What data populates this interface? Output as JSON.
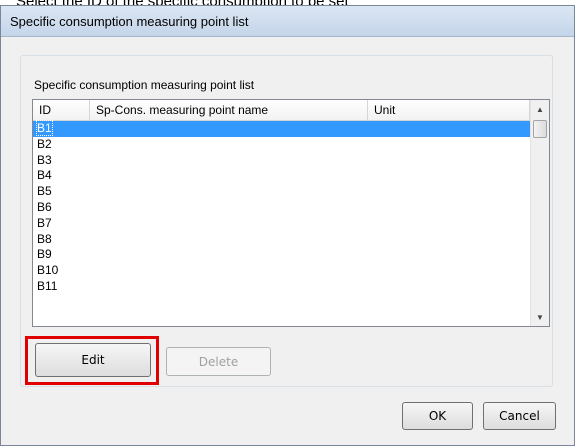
{
  "caption": {
    "text": "Select the ID of the specific consumption to be set"
  },
  "dialog": {
    "title": "Specific consumption measuring point list",
    "group_label": "Specific consumption measuring point list",
    "list": {
      "columns": [
        "ID",
        "Sp-Cons. measuring point name",
        "Unit"
      ],
      "rows": [
        "B1",
        "B2",
        "B3",
        "B4",
        "B5",
        "B6",
        "B7",
        "B8",
        "B9",
        "B10",
        "B11"
      ],
      "selected_row": "B1"
    },
    "buttons": {
      "edit": "Edit",
      "delete": "Delete",
      "ok": "OK",
      "cancel": "Cancel"
    }
  },
  "colors": {
    "selection": "#3399ff",
    "highlight": "#e00000"
  },
  "icons": {
    "scroll_up": "scroll-up-arrow-icon",
    "scroll_down": "scroll-down-arrow-icon"
  }
}
